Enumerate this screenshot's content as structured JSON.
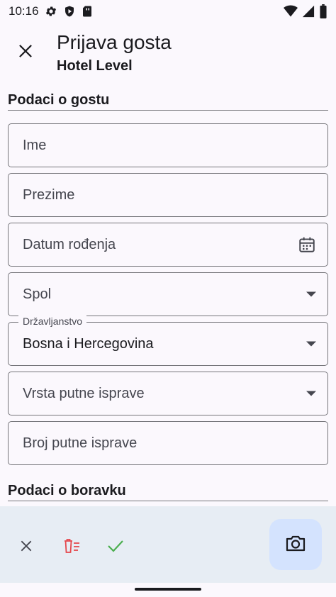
{
  "status_bar": {
    "time": "10:16",
    "left_icons": [
      "gear-icon",
      "shield-icon",
      "sim-card-icon"
    ],
    "right_icons": [
      "wifi-icon",
      "signal-icon",
      "battery-icon"
    ]
  },
  "app_bar": {
    "close_icon": "close-icon",
    "title": "Prijava gosta",
    "subtitle": "Hotel Level"
  },
  "sections": {
    "guest": "Podaci o gostu",
    "stay": "Podaci o boravku"
  },
  "fields": {
    "first_name": {
      "placeholder": "Ime",
      "value": ""
    },
    "last_name": {
      "placeholder": "Prezime",
      "value": ""
    },
    "birth_date": {
      "placeholder": "Datum rođenja",
      "value": "",
      "icon": "calendar-icon"
    },
    "gender": {
      "placeholder": "Spol",
      "value": "",
      "icon": "dropdown-arrow-icon"
    },
    "citizenship": {
      "label": "Državljanstvo",
      "value": "Bosna i Hercegovina",
      "icon": "dropdown-arrow-icon"
    },
    "document_type": {
      "placeholder": "Vrsta putne isprave",
      "value": "",
      "icon": "dropdown-arrow-icon"
    },
    "document_number": {
      "placeholder": "Broj putne isprave",
      "value": ""
    }
  },
  "bottom_bar": {
    "actions": [
      "close-icon",
      "delete-list-icon",
      "check-icon"
    ],
    "fab_icon": "camera-icon"
  },
  "colors": {
    "background": "#fbf8fd",
    "bottom_bar": "#e7edf4",
    "fab": "#d4e3fe",
    "delete": "#e5484d",
    "confirm": "#4caf50",
    "outline": "#75757a"
  }
}
